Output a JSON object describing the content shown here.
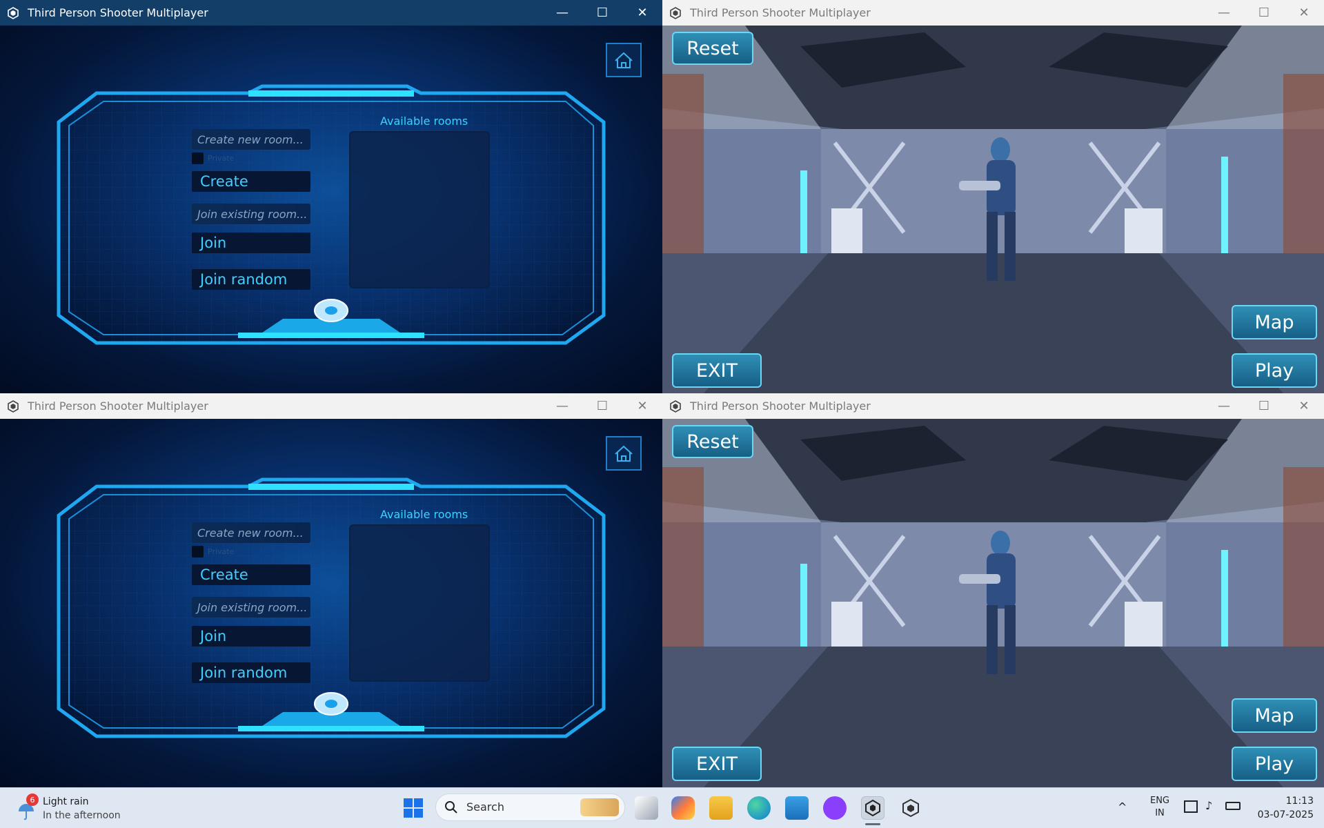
{
  "windows": [
    {
      "title": "Third Person Shooter Multiplayer",
      "active": true,
      "kind": "lobby"
    },
    {
      "title": "Third Person Shooter Multiplayer",
      "active": false,
      "kind": "game"
    },
    {
      "title": "Third Person Shooter Multiplayer",
      "active": false,
      "kind": "lobby"
    },
    {
      "title": "Third Person Shooter Multiplayer",
      "active": false,
      "kind": "game"
    }
  ],
  "window_controls": {
    "minimize": "—",
    "maximize": "☐",
    "close": "✕"
  },
  "lobby": {
    "create_placeholder": "Create new room...",
    "private_label": "Private",
    "create_button": "Create",
    "join_placeholder": "Join existing room...",
    "join_button": "Join",
    "join_random_button": "Join random",
    "rooms_title": "Available rooms",
    "rooms": []
  },
  "game": {
    "reset_button": "Reset",
    "exit_button": "EXIT",
    "map_button": "Map",
    "play_button": "Play"
  },
  "taskbar": {
    "weather": {
      "badge": "6",
      "title": "Light rain",
      "subtitle": "In the afternoon"
    },
    "search_placeholder": "Search",
    "pinned_icons": [
      "start-icon",
      "search-icon",
      "task-view-icon",
      "copilot-icon",
      "file-explorer-icon",
      "edge-icon",
      "notepad-icon",
      "github-desktop-icon",
      "unity-icon",
      "unity-hub-icon"
    ],
    "tray": {
      "lang_top": "ENG",
      "lang_bottom": "IN",
      "time": "11:13",
      "date": "03-07-2025"
    }
  },
  "colors": {
    "accent": "#3fd0ff",
    "titlebar_active": "#123e67",
    "lobby_bg": "#083270",
    "game_button": "#2f8fb5"
  }
}
